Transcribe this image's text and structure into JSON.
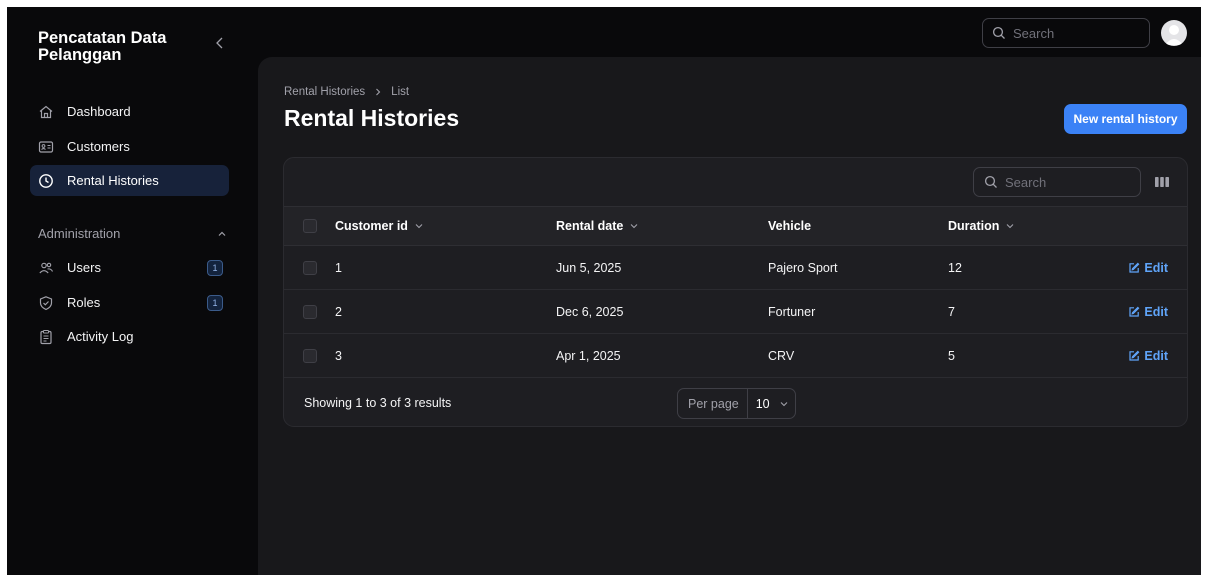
{
  "app": {
    "brand": "Pencatatan Data Pelanggan"
  },
  "sidebar": {
    "items": [
      {
        "label": "Dashboard",
        "icon": "home-icon"
      },
      {
        "label": "Customers",
        "icon": "id-card-icon"
      },
      {
        "label": "Rental Histories",
        "icon": "clock-icon",
        "active": true
      }
    ],
    "group_label": "Administration",
    "admin_items": [
      {
        "label": "Users",
        "icon": "users-icon",
        "badge": "1"
      },
      {
        "label": "Roles",
        "icon": "shield-check-icon",
        "badge": "1"
      },
      {
        "label": "Activity Log",
        "icon": "clipboard-icon"
      }
    ]
  },
  "topbar": {
    "search_placeholder": "Search"
  },
  "page": {
    "breadcrumb": [
      "Rental Histories",
      "List"
    ],
    "title": "Rental Histories",
    "new_button": "New rental history"
  },
  "table": {
    "search_placeholder": "Search",
    "columns": [
      "Customer id",
      "Rental date",
      "Vehicle",
      "Duration"
    ],
    "rows": [
      {
        "customer_id": "1",
        "rental_date": "Jun 5, 2025",
        "vehicle": "Pajero Sport",
        "duration": "12"
      },
      {
        "customer_id": "2",
        "rental_date": "Dec 6, 2025",
        "vehicle": "Fortuner",
        "duration": "7"
      },
      {
        "customer_id": "3",
        "rental_date": "Apr 1, 2025",
        "vehicle": "CRV",
        "duration": "5"
      }
    ],
    "edit_label": "Edit",
    "showing": "Showing 1 to 3 of 3 results",
    "per_page_label": "Per page",
    "per_page_value": "10"
  },
  "colors": {
    "accent": "#3b82f6",
    "link": "#60a5fa",
    "active_nav": "#17223a",
    "background": "#09090b",
    "panel": "#18181b"
  }
}
